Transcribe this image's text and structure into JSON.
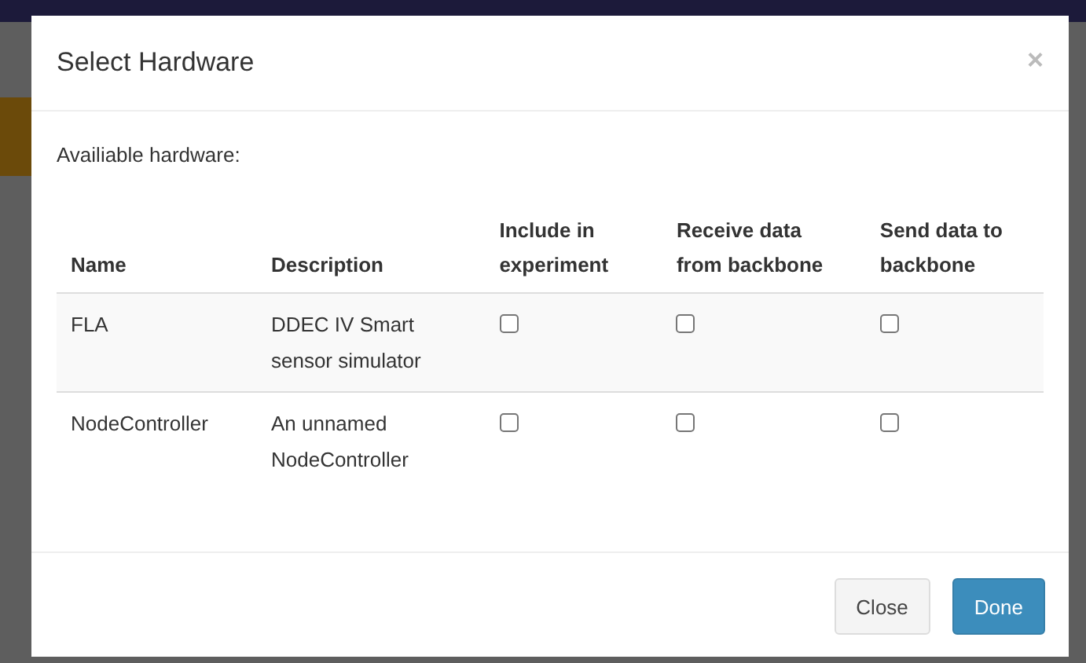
{
  "dialog": {
    "title": "Select Hardware",
    "close_symbol": "×",
    "intro": "Availiable hardware:",
    "table": {
      "columns": [
        "Name",
        "Description",
        "Include in experiment",
        "Receive data from backbone",
        "Send data to backbone"
      ],
      "rows": [
        {
          "name": "FLA",
          "description": "DDEC IV Smart sensor simulator",
          "include": false,
          "receive": false,
          "send": false
        },
        {
          "name": "NodeController",
          "description": "An unnamed NodeController",
          "include": false,
          "receive": false,
          "send": false
        }
      ]
    },
    "buttons": [
      {
        "label": "Close",
        "kind": "default"
      },
      {
        "label": "Done",
        "kind": "primary"
      }
    ]
  }
}
